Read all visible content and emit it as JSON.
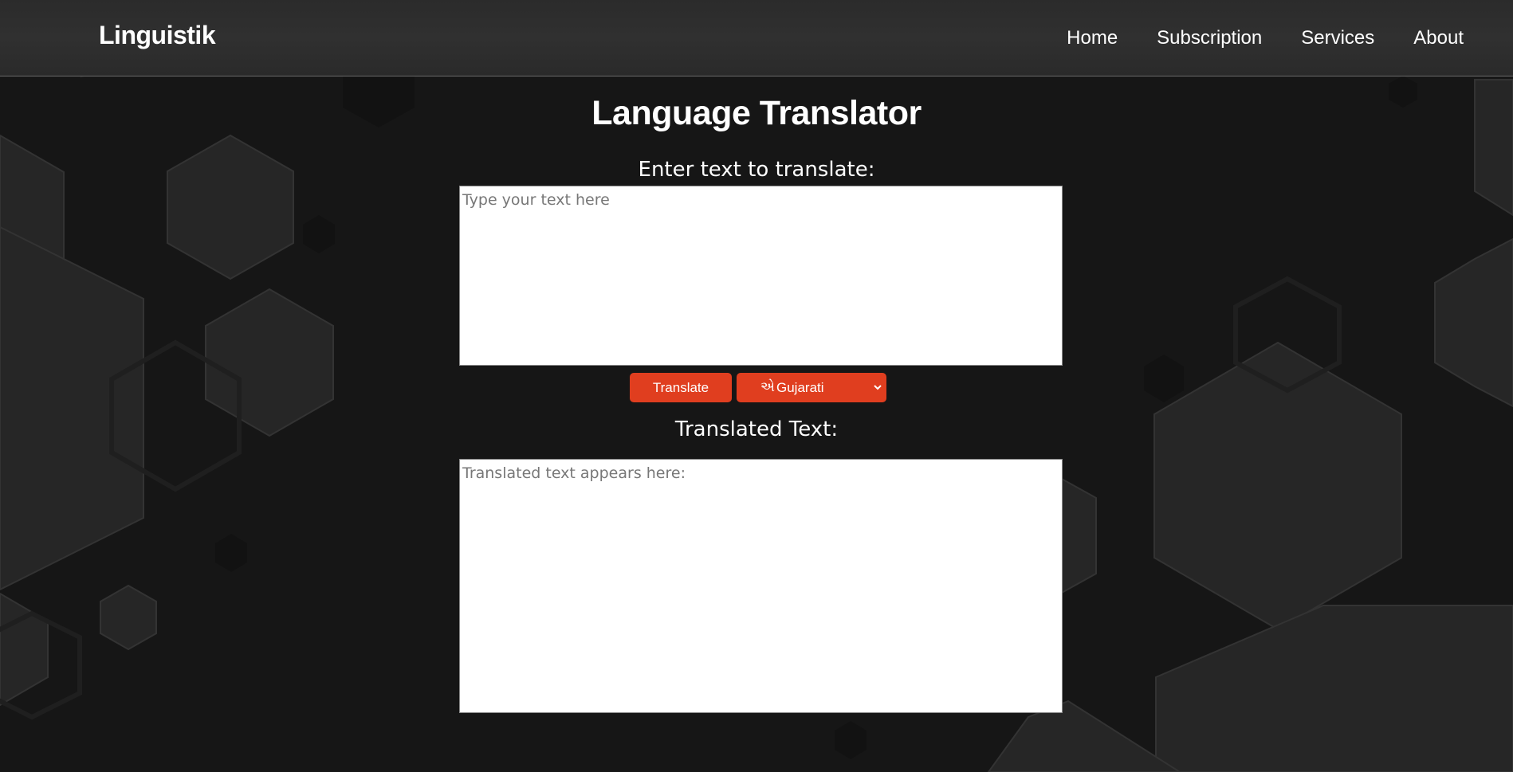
{
  "app": {
    "logo": "Linguistik"
  },
  "nav": {
    "items": [
      {
        "label": "Home"
      },
      {
        "label": "Subscription"
      },
      {
        "label": "Services"
      },
      {
        "label": "About"
      }
    ]
  },
  "main": {
    "title": "Language Translator",
    "input_label": "Enter text to translate:",
    "input_placeholder": "Type your text here",
    "input_value": "",
    "translate_button": "Translate",
    "language_select": {
      "glyph": "એ",
      "selected": "Gujarati",
      "icon": "chevron-down-icon"
    },
    "output_label": "Translated Text:",
    "output_placeholder": "Translated text appears here:",
    "output_value": ""
  },
  "colors": {
    "background": "#161616",
    "navbar": "#2e2e2e",
    "accent": "#e03e1f",
    "text": "#ffffff",
    "hexagon": "#2a2a2a"
  }
}
